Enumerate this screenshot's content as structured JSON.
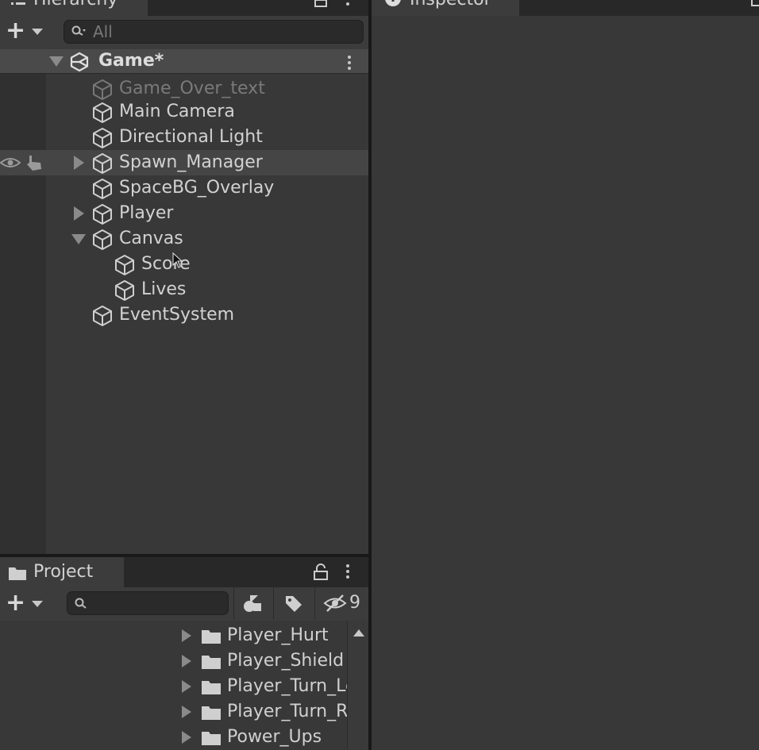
{
  "hierarchy": {
    "tab_label": "Hierarchy",
    "search_placeholder": "All",
    "scene": {
      "name": "Game*"
    },
    "items": [
      {
        "label": "Game_Over_text",
        "inactive": true
      },
      {
        "label": "Main Camera"
      },
      {
        "label": "Directional Light"
      },
      {
        "label": "Spawn_Manager"
      },
      {
        "label": "SpaceBG_Overlay"
      },
      {
        "label": "Player"
      },
      {
        "label": "Canvas"
      },
      {
        "label": "Score"
      },
      {
        "label": "Lives"
      },
      {
        "label": "EventSystem"
      }
    ]
  },
  "inspector": {
    "tab_label": "Inspector"
  },
  "project": {
    "tab_label": "Project",
    "hidden_count": "9",
    "folders": [
      {
        "label": "Player_Hurt"
      },
      {
        "label": "Player_Shield"
      },
      {
        "label": "Player_Turn_Left"
      },
      {
        "label": "Player_Turn_Right"
      },
      {
        "label": "Power_Ups"
      }
    ]
  },
  "colors": {
    "panel_bg": "#383838",
    "tab_strip": "#282828",
    "text": "#c4c4c4",
    "text_inactive": "#7a7a7a",
    "hover_row": "#454545"
  },
  "icons": {
    "game_object": "cube-icon",
    "scene": "unity-logo-icon",
    "folder": "folder-icon",
    "visibility": "eye-icon",
    "pickable": "hand-icon"
  }
}
